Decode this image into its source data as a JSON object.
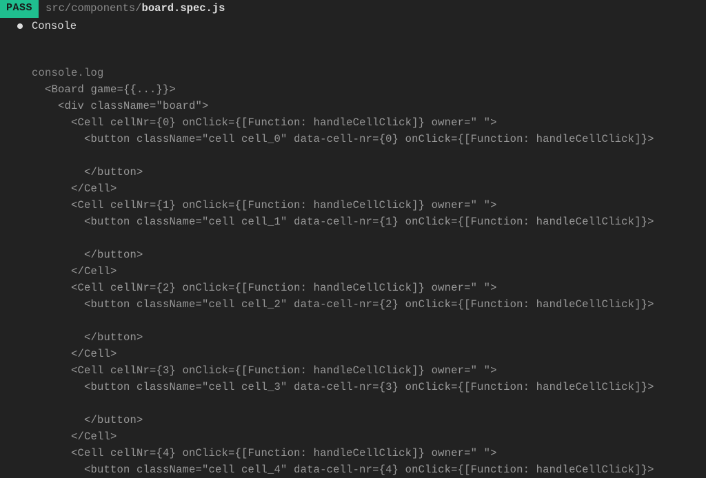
{
  "header": {
    "status": "PASS",
    "pathPrefix": "src/components/",
    "filename": "board.spec.js"
  },
  "console": {
    "label": "Console",
    "logLabel": "console.log"
  },
  "tree": {
    "root": {
      "open": "<Board game={{...}}>",
      "div": {
        "open": "<div className=\"board\">"
      }
    },
    "cells": [
      {
        "open": "<Cell cellNr={0} onClick={[Function: handleCellClick]} owner=\" \">",
        "button": "<button className=\"cell cell_0\" data-cell-nr={0} onClick={[Function: handleCellClick]}>",
        "buttonClose": "</button>",
        "close": "</Cell>"
      },
      {
        "open": "<Cell cellNr={1} onClick={[Function: handleCellClick]} owner=\" \">",
        "button": "<button className=\"cell cell_1\" data-cell-nr={1} onClick={[Function: handleCellClick]}>",
        "buttonClose": "</button>",
        "close": "</Cell>"
      },
      {
        "open": "<Cell cellNr={2} onClick={[Function: handleCellClick]} owner=\" \">",
        "button": "<button className=\"cell cell_2\" data-cell-nr={2} onClick={[Function: handleCellClick]}>",
        "buttonClose": "</button>",
        "close": "</Cell>"
      },
      {
        "open": "<Cell cellNr={3} onClick={[Function: handleCellClick]} owner=\" \">",
        "button": "<button className=\"cell cell_3\" data-cell-nr={3} onClick={[Function: handleCellClick]}>",
        "buttonClose": "</button>",
        "close": "</Cell>"
      },
      {
        "open": "<Cell cellNr={4} onClick={[Function: handleCellClick]} owner=\" \">",
        "button": "<button className=\"cell cell_4\" data-cell-nr={4} onClick={[Function: handleCellClick]}>"
      }
    ]
  },
  "indent": {
    "i2": "  ",
    "i4": "    ",
    "i6": "      ",
    "i8": "        "
  }
}
